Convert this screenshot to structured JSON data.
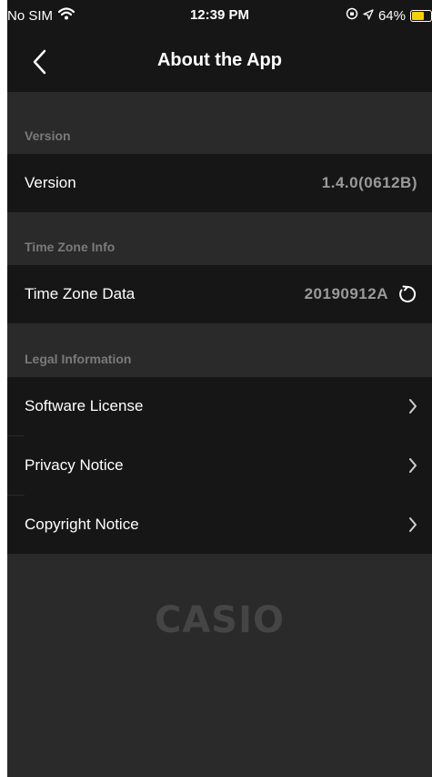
{
  "status_bar": {
    "carrier": "No SIM",
    "time": "12:39 PM",
    "battery": "64%",
    "battery_level": 0.64,
    "battery_color": "#f5d000"
  },
  "nav": {
    "title": "About the App",
    "back_icon": "chevron-left-icon"
  },
  "sections": {
    "version": {
      "header": "Version",
      "row_label": "Version",
      "row_value": "1.4.0(0612B)"
    },
    "timezone": {
      "header": "Time Zone Info",
      "row_label": "Time Zone Data",
      "row_value": "20190912A",
      "refresh_icon": "refresh-icon"
    },
    "legal": {
      "header": "Legal Information",
      "items": [
        {
          "label": "Software License",
          "icon": "chevron-right-icon"
        },
        {
          "label": "Privacy Notice",
          "icon": "chevron-right-icon"
        },
        {
          "label": "Copyright Notice",
          "icon": "chevron-right-icon"
        }
      ]
    }
  },
  "footer": {
    "logo": "CASIO"
  }
}
